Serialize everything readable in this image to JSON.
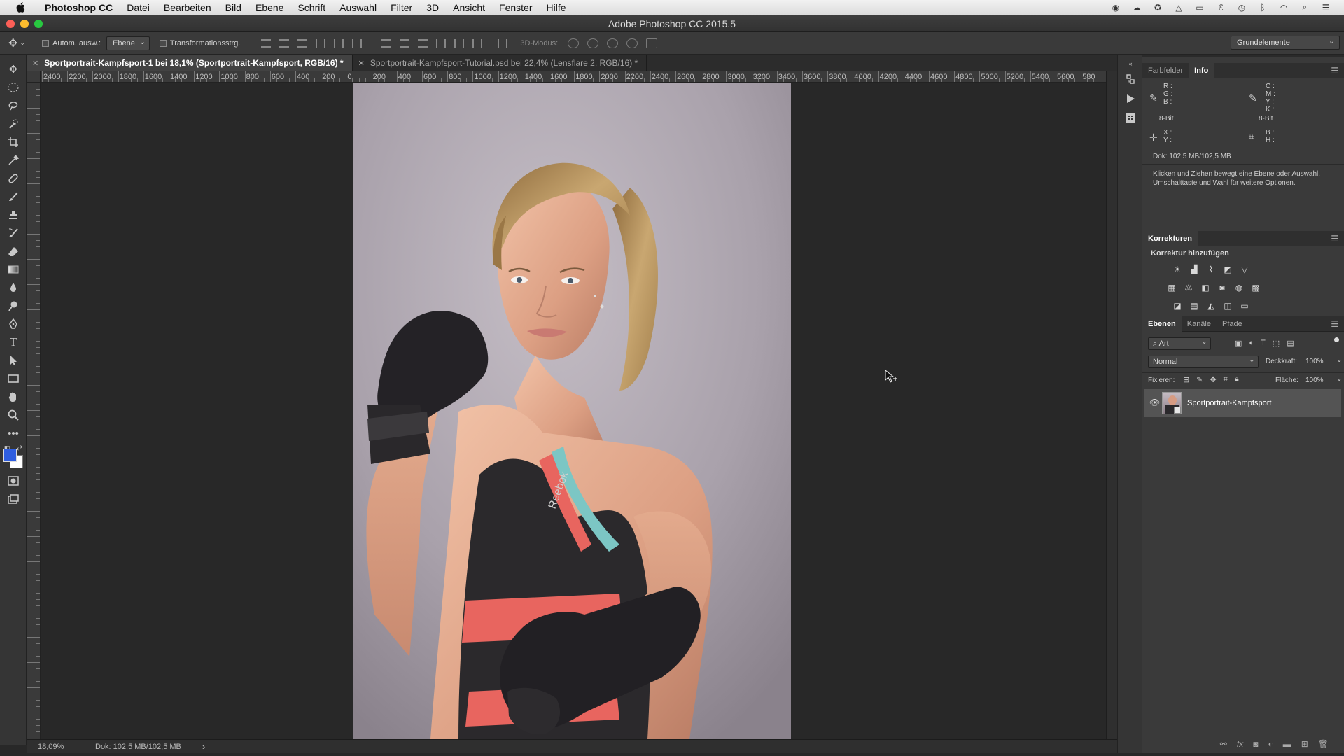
{
  "mac_menu": {
    "app": "Photoshop CC",
    "items": [
      "Datei",
      "Bearbeiten",
      "Bild",
      "Ebene",
      "Schrift",
      "Auswahl",
      "Filter",
      "3D",
      "Ansicht",
      "Fenster",
      "Hilfe"
    ]
  },
  "window": {
    "title": "Adobe Photoshop CC 2015.5"
  },
  "options_bar": {
    "auto_select_label": "Autom. ausw.:",
    "auto_select_target": "Ebene",
    "transform_label": "Transformationsstrg.",
    "mode_3d_label": "3D-Modus:",
    "workspace": "Grundelemente"
  },
  "doc_tabs": [
    {
      "label": "Sportportrait-Kampfsport-1 bei 18,1% (Sportportrait-Kampfsport, RGB/16) *",
      "active": true
    },
    {
      "label": "Sportportrait-Kampfsport-Tutorial.psd bei 22,4% (Lensflare 2, RGB/16) *",
      "active": false
    }
  ],
  "ruler_top": [
    "2400",
    "2200",
    "2000",
    "1800",
    "1600",
    "1400",
    "1200",
    "1000",
    "800",
    "600",
    "400",
    "200",
    "0",
    "200",
    "400",
    "600",
    "800",
    "1000",
    "1200",
    "1400",
    "1600",
    "1800",
    "2000",
    "2200",
    "2400",
    "2600",
    "2800",
    "3000",
    "3200",
    "3400",
    "3600",
    "3800",
    "4000",
    "4200",
    "4400",
    "4600",
    "4800",
    "5000",
    "5200",
    "5400",
    "5600",
    "580"
  ],
  "status": {
    "zoom": "18,09%",
    "doc": "Dok: 102,5 MB/102,5 MB",
    "arrow": "›"
  },
  "info_panel": {
    "tabs": [
      "Farbfelder",
      "Info"
    ],
    "rgb_labels": [
      "R :",
      "G :",
      "B :"
    ],
    "cmyk_labels": [
      "C :",
      "M :",
      "Y :",
      "K :"
    ],
    "bit_left": "8-Bit",
    "bit_right": "8-Bit",
    "xy_labels": [
      "X :",
      "Y :"
    ],
    "wh_labels": [
      "B :",
      "H :"
    ],
    "doc": "Dok: 102,5 MB/102,5 MB",
    "hint": "Klicken und Ziehen bewegt eine Ebene oder Auswahl. Umschalttaste und Wahl für weitere Optionen."
  },
  "adjustments_panel": {
    "title": "Korrekturen",
    "subtitle": "Korrektur hinzufügen"
  },
  "layers_panel": {
    "tabs": [
      "Ebenen",
      "Kanäle",
      "Pfade"
    ],
    "filter": "Art",
    "blend_mode": "Normal",
    "opacity_label": "Deckkraft:",
    "opacity_value": "100%",
    "lock_label": "Fixieren:",
    "fill_label": "Fläche:",
    "fill_value": "100%",
    "layers": [
      {
        "name": "Sportportrait-Kampfsport"
      }
    ]
  },
  "colors": {
    "foreground": "#2f5ee0",
    "background": "#ffffff",
    "accent": "#e8655f",
    "teal": "#7cc6c4"
  }
}
